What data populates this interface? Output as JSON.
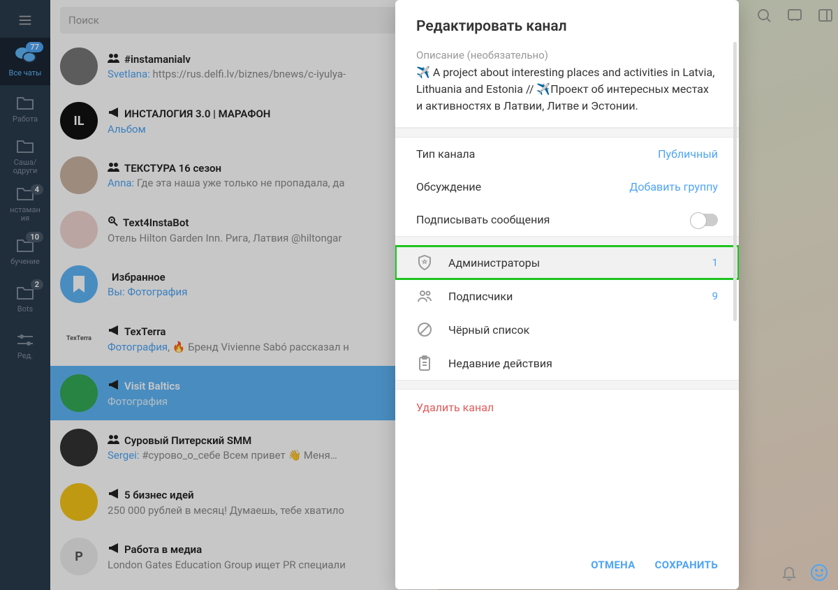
{
  "search": {
    "placeholder": "Поиск"
  },
  "rail": {
    "items": [
      {
        "label": "Все чаты",
        "badge": "77",
        "active": true
      },
      {
        "label": "Работа"
      },
      {
        "label": "Саша/\nодруги"
      },
      {
        "label": "нстаман\nия",
        "badge": "4"
      },
      {
        "label": "бучение",
        "badge": "10"
      },
      {
        "label": "Bots",
        "badge": "2"
      },
      {
        "label": "Ред."
      }
    ]
  },
  "chats": [
    {
      "title": "#instamanialv",
      "type": "group",
      "sender": "Svetlana",
      "snippet": "https://rus.delfi.lv/biznes/bnews/c-iyulya-",
      "ava": "#777"
    },
    {
      "title": "ИНСТАЛОГИЯ 3.0 | МАРАФОН",
      "type": "channel",
      "snippet": "Альбом",
      "snippet_link": true,
      "ava": "#111",
      "ava_text": "IL"
    },
    {
      "title": "ТЕКСТУРА 16 сезон",
      "type": "group",
      "sender": "Anna",
      "snippet": "Где эта наша уже только не пропадала, да",
      "ava": "#c9b2a0"
    },
    {
      "title": "Text4InstaBot",
      "type": "bot",
      "snippet": "Отель Hilton Garden Inn. Рига, Латвия @hiltongar",
      "ava": "#efd4d0"
    },
    {
      "title": "Избранное",
      "type": "saved",
      "sender": "Вы",
      "snippet": "Фотография",
      "snippet_link": true,
      "ava": "#5eb5f7"
    },
    {
      "title": "TexTerra",
      "type": "channel",
      "snippet": "Фотография, 🔥 Бренд Vivienne Sabó рассказал н",
      "snippet_link_prefix": "Фотография",
      "ava": "#fff",
      "ava_text": "TexTerra"
    },
    {
      "title": "Visit Baltics",
      "type": "channel",
      "snippet": "Фотография",
      "selected": true,
      "ava": "#3a5",
      "ava_text": ""
    },
    {
      "title": "Суровый Питерский SMM",
      "type": "group",
      "sender": "Sergei",
      "snippet": "#сурово_о_себе  Всем привет 👋  Меня…",
      "ava": "#333"
    },
    {
      "title": "5 бизнес идей",
      "type": "channel",
      "snippet": "250 000 рублей в месяц!  Думаешь, тебе хватило",
      "ava": "#f5c518"
    },
    {
      "title": "Работа в медиа",
      "type": "channel",
      "snippet": "London Gates Education Group ищет PR специали",
      "ava": "#eee",
      "ava_text": "Р"
    }
  ],
  "modal": {
    "title": "Редактировать канал",
    "desc_label": "Описание (необязательно)",
    "desc_text": "✈️ A project about interesting places and activities in Latvia, Lithuania and Estonia // ✈️Проект об интересных местах и активностях в Латвии, Литве и Эстонии.",
    "type_label": "Тип канала",
    "type_value": "Публичный",
    "discussion_label": "Обсуждение",
    "discussion_value": "Добавить группу",
    "sign_label": "Подписывать сообщения",
    "mgmt": [
      {
        "label": "Администраторы",
        "count": "1",
        "highlighted": true
      },
      {
        "label": "Подписчики",
        "count": "9"
      },
      {
        "label": "Чёрный список"
      },
      {
        "label": "Недавние действия"
      }
    ],
    "delete": "Удалить канал",
    "cancel": "ОТМЕНА",
    "save": "СОХРАНИТЬ"
  }
}
